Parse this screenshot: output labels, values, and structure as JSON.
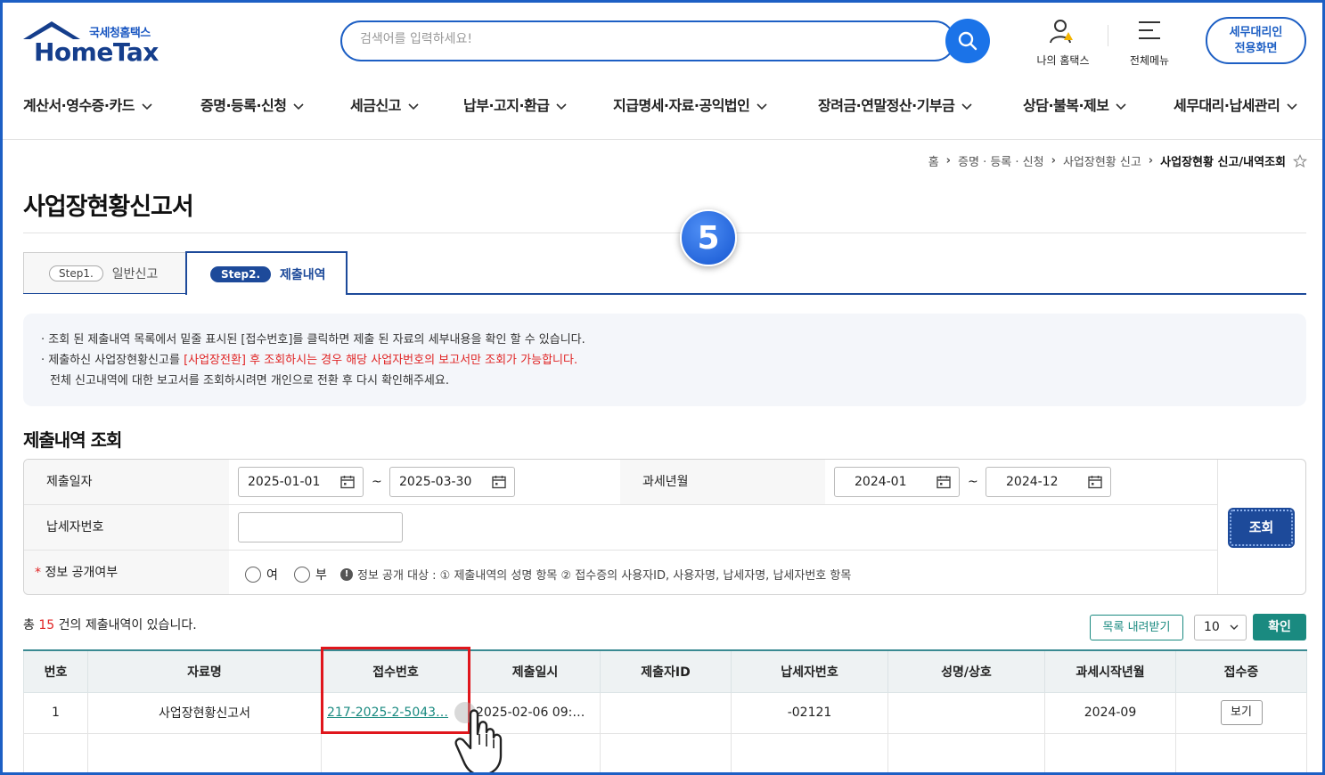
{
  "header": {
    "logo_kor": "국세청홈택스",
    "logo_eng": "HomeTax",
    "search_placeholder": "검색어를 입력하세요!",
    "my_hometax": "나의 홈택스",
    "all_menu": "전체메뉴",
    "agent_line1": "세무대리인",
    "agent_line2": "전용화면"
  },
  "nav": [
    "계산서·영수증·카드",
    "증명·등록·신청",
    "세금신고",
    "납부·고지·환급",
    "지급명세·자료·공익법인",
    "장려금·연말정산·기부금",
    "상담·불복·제보",
    "세무대리·납세관리"
  ],
  "breadcrumb": [
    "홈",
    "증명 · 등록 · 신청",
    "사업장현황 신고",
    "사업장현황 신고/내역조회"
  ],
  "page_title": "사업장현황신고서",
  "step_marker": "5",
  "tabs": [
    {
      "pill": "Step1.",
      "label": "일반신고"
    },
    {
      "pill": "Step2.",
      "label": "제출내역"
    }
  ],
  "notice": {
    "line1": "조회 된 제출내역 목록에서 밑줄 표시된 [접수번호]를 클릭하면 제출 된 자료의 세부내용을 확인 할 수 있습니다.",
    "line2_pre": "제출하신 사업장현황신고를 ",
    "line2_red": "[사업장전환] 후 조회하시는 경우 해당 사업자번호의 보고서만 조회가 가능합니다.",
    "line3": "전체 신고내역에 대한 보고서를 조회하시려면 개인으로 전환 후 다시 확인해주세요."
  },
  "section_title": "제출내역 조회",
  "form": {
    "submit_date_label": "제출일자",
    "submit_from": "2025-01-01",
    "submit_to": "2025-03-30",
    "tilde": "~",
    "tax_period_label": "과세년월",
    "period_from": "2024-01",
    "period_to": "2024-12",
    "taxpayer_no_label": "납세자번호",
    "taxpayer_no_value": "",
    "disclosure_label": "정보 공개여부",
    "required_mark": "*",
    "opt_yes": "여",
    "opt_no": "부",
    "info_text": "정보 공개 대상 : ① 제출내역의 성명 항목 ② 접수증의 사용자ID, 사용자명, 납세자명, 납세자번호 항목",
    "search_button": "조회"
  },
  "results": {
    "total_pre": "총 ",
    "total_count": "15",
    "total_post": " 건의 제출내역이 있습니다.",
    "download_button": "목록 내려받기",
    "page_size": "10",
    "confirm_button": "확인"
  },
  "table": {
    "headers": [
      "번호",
      "자료명",
      "접수번호",
      "제출일시",
      "제출자ID",
      "납세자번호",
      "성명/상호",
      "과세시작년월",
      "접수증"
    ],
    "rows": [
      {
        "no": "1",
        "name": "사업장현황신고서",
        "receipt_no": "217-2025-2-5043…",
        "submitted_at": "2025-02-06 09:…",
        "submitter_id": "",
        "taxpayer_no": "-02121",
        "owner": "",
        "period_start": "2024-09",
        "view": "보기"
      }
    ]
  },
  "colors": {
    "primary": "#1d4a9a",
    "accent_blue": "#1b73e8",
    "teal": "#1a8a80",
    "red": "#e02424"
  }
}
